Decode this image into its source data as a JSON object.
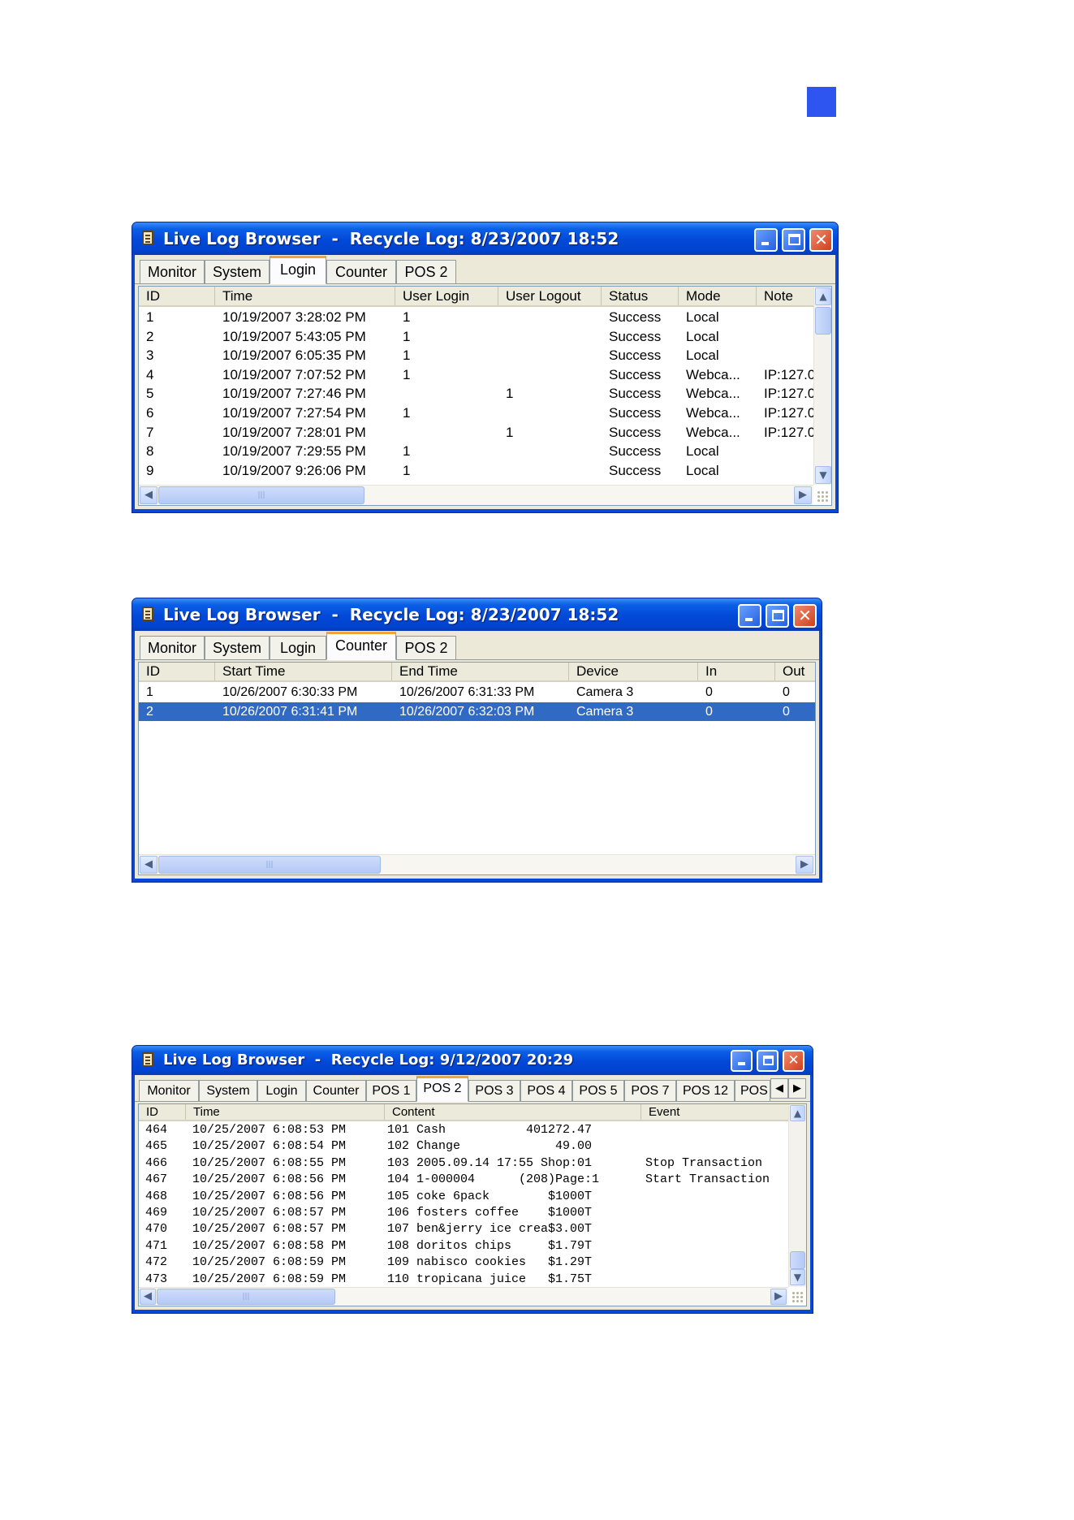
{
  "page_marker": {
    "color": "#2f55f0"
  },
  "windows": [
    {
      "title": "Live Log Browser  -  Recycle Log: 8/23/2007 18:52",
      "tabs": [
        "Monitor",
        "System",
        "Login",
        "Counter",
        "POS 2"
      ],
      "active_tab": "Login",
      "columns": [
        "ID",
        "Time",
        "User Login",
        "User Logout",
        "Status",
        "Mode",
        "Note"
      ],
      "rows": [
        [
          "1",
          "10/19/2007 3:28:02 PM",
          "1",
          "",
          "Success",
          "Local",
          ""
        ],
        [
          "2",
          "10/19/2007 5:43:05 PM",
          "1",
          "",
          "Success",
          "Local",
          ""
        ],
        [
          "3",
          "10/19/2007 6:05:35 PM",
          "1",
          "",
          "Success",
          "Local",
          ""
        ],
        [
          "4",
          "10/19/2007 7:07:52 PM",
          "1",
          "",
          "Success",
          "Webca...",
          "IP:127.0"
        ],
        [
          "5",
          "10/19/2007 7:27:46 PM",
          "",
          "1",
          "Success",
          "Webca...",
          "IP:127.0"
        ],
        [
          "6",
          "10/19/2007 7:27:54 PM",
          "1",
          "",
          "Success",
          "Webca...",
          "IP:127.0"
        ],
        [
          "7",
          "10/19/2007 7:28:01 PM",
          "",
          "1",
          "Success",
          "Webca...",
          "IP:127.0"
        ],
        [
          "8",
          "10/19/2007 7:29:55 PM",
          "1",
          "",
          "Success",
          "Local",
          ""
        ],
        [
          "9",
          "10/19/2007 9:26:06 PM",
          "1",
          "",
          "Success",
          "Local",
          ""
        ]
      ]
    },
    {
      "title": "Live Log Browser  -  Recycle Log: 8/23/2007 18:52",
      "tabs": [
        "Monitor",
        "System",
        "Login",
        "Counter",
        "POS 2"
      ],
      "active_tab": "Counter",
      "columns": [
        "ID",
        "Start Time",
        "End Time",
        "Device",
        "In",
        "Out"
      ],
      "rows": [
        [
          "1",
          "10/26/2007 6:30:33 PM",
          "10/26/2007 6:31:33 PM",
          "Camera 3",
          "0",
          "0"
        ],
        [
          "2",
          "10/26/2007 6:31:41 PM",
          "10/26/2007 6:32:03 PM",
          "Camera 3",
          "0",
          "0"
        ]
      ],
      "selected_row": "2"
    },
    {
      "title": "Live Log Browser  -  Recycle Log: 9/12/2007 20:29",
      "tabs": [
        "Monitor",
        "System",
        "Login",
        "Counter",
        "POS 1",
        "POS 2",
        "POS 3",
        "POS 4",
        "POS 5",
        "POS 7",
        "POS 12",
        "POS"
      ],
      "active_tab": "POS 2",
      "columns": [
        "ID",
        "Time",
        "Content",
        "Event"
      ],
      "rows": [
        [
          "464",
          "10/25/2007 6:08:53 PM",
          "101 Cash           401272.47",
          ""
        ],
        [
          "465",
          "10/25/2007 6:08:54 PM",
          "102 Change             49.00",
          ""
        ],
        [
          "466",
          "10/25/2007 6:08:55 PM",
          "103 2005.09.14 17:55 Shop:01",
          "Stop Transaction"
        ],
        [
          "467",
          "10/25/2007 6:08:56 PM",
          "104 1-000004      (208)Page:1",
          "Start Transaction"
        ],
        [
          "468",
          "10/25/2007 6:08:56 PM",
          "105 coke 6pack        $1000T",
          ""
        ],
        [
          "469",
          "10/25/2007 6:08:57 PM",
          "106 fosters coffee    $1000T",
          ""
        ],
        [
          "470",
          "10/25/2007 6:08:57 PM",
          "107 ben&jerry ice crea$3.00T",
          ""
        ],
        [
          "471",
          "10/25/2007 6:08:58 PM",
          "108 doritos chips     $1.79T",
          ""
        ],
        [
          "472",
          "10/25/2007 6:08:59 PM",
          "109 nabisco cookies   $1.29T",
          ""
        ],
        [
          "473",
          "10/25/2007 6:08:59 PM",
          "110 tropicana juice   $1.75T",
          ""
        ]
      ]
    }
  ],
  "icons": {
    "window": "log-document-icon",
    "minimize": "minimize-icon",
    "maximize": "maximize-icon",
    "close": "close-icon",
    "scroll_left": "scroll-left-arrow-icon",
    "scroll_right": "scroll-right-arrow-icon",
    "scroll_up": "scroll-up-arrow-icon",
    "scroll_down": "scroll-down-arrow-icon",
    "tab_left": "tab-scroll-left-icon",
    "tab_right": "tab-scroll-right-icon",
    "grip": "resize-grip-icon"
  },
  "glyphs": {
    "close": "✕",
    "left": "◀",
    "right": "▶",
    "up": "▲",
    "down": "▼",
    "thumb_grip": "|||"
  }
}
